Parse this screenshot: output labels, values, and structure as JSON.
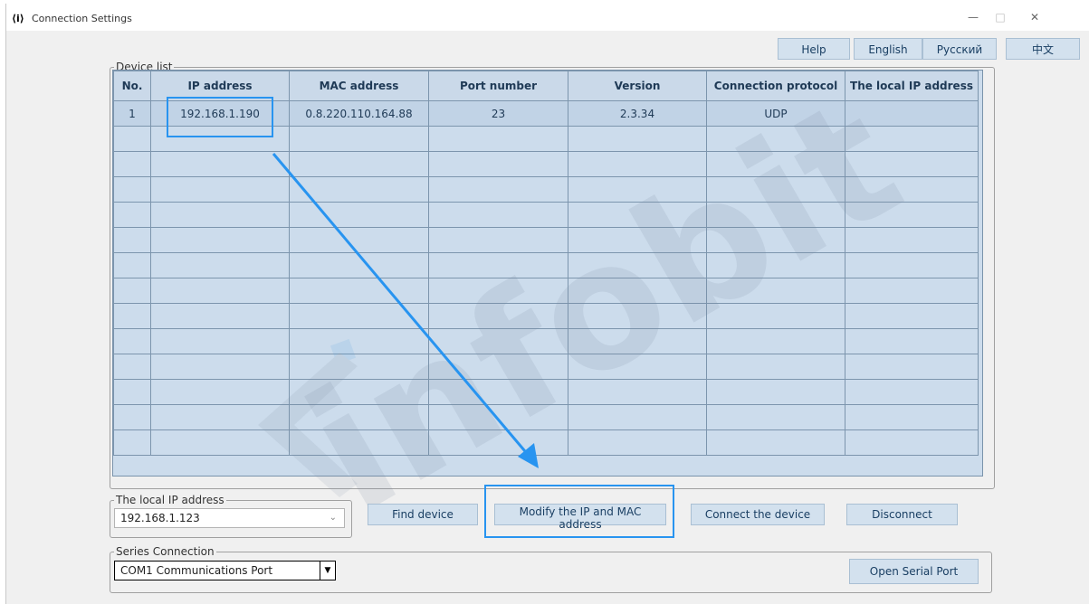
{
  "window": {
    "title": "Connection Settings",
    "icon_glyph": "⟨i⟩",
    "minimize": "—",
    "maximize": "□",
    "close": "✕"
  },
  "header_buttons": {
    "help": "Help",
    "english": "English",
    "russian": "Русский",
    "chinese": "中文"
  },
  "device_list": {
    "legend": "Device list",
    "columns": [
      "No.",
      "IP address",
      "MAC address",
      "Port number",
      "Version",
      "Connection protocol",
      "The local IP address"
    ],
    "rows": [
      [
        "1",
        "192.168.1.190",
        "0.8.220.110.164.88",
        "23",
        "2.3.34",
        "UDP",
        ""
      ]
    ]
  },
  "local_ip": {
    "legend": "The local IP address",
    "value": "192.168.1.123"
  },
  "actions": {
    "find": "Find device",
    "modify": "Modify the IP and MAC address",
    "connect": "Connect the device",
    "disconnect": "Disconnect"
  },
  "serial": {
    "legend": "Series Connection",
    "port": "COM1 Communications Port",
    "open": "Open Serial Port"
  },
  "watermark": {
    "text": "infobit"
  },
  "colors": {
    "accent": "#2894f0",
    "button_bg": "#d3e1ee",
    "table_bg": "#ccdcec"
  }
}
